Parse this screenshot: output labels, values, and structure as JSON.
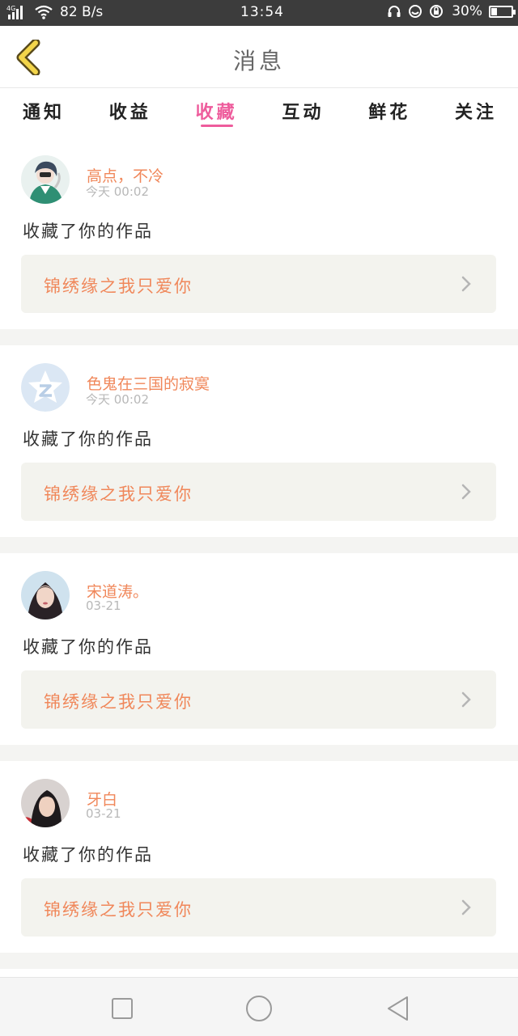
{
  "status_bar": {
    "network": "4G",
    "speed": "82 B/s",
    "time": "13:54",
    "battery": "30%",
    "battery_level": 0.3
  },
  "header": {
    "title": "消息"
  },
  "tabs": [
    {
      "label": "通知",
      "active": false
    },
    {
      "label": "收益",
      "active": false
    },
    {
      "label": "收藏",
      "active": true
    },
    {
      "label": "互动",
      "active": false
    },
    {
      "label": "鲜花",
      "active": false
    },
    {
      "label": "关注",
      "active": false
    }
  ],
  "messages": [
    {
      "username": "高点，不冷",
      "time": "今天 00:02",
      "action": "收藏了你的作品",
      "work": "锦绣缘之我只爱你",
      "avatar": "anime-avatar"
    },
    {
      "username": "色鬼在三国的寂寞",
      "time": "今天 00:02",
      "action": "收藏了你的作品",
      "work": "锦绣缘之我只爱你",
      "avatar": "default-avatar"
    },
    {
      "username": "宋道涛。",
      "time": "03-21",
      "action": "收藏了你的作品",
      "work": "锦绣缘之我只爱你",
      "avatar": "photo-avatar"
    },
    {
      "username": "牙白",
      "time": "03-21",
      "action": "收藏了你的作品",
      "work": "锦绣缘之我只爱你",
      "avatar": "photo-avatar"
    }
  ],
  "colors": {
    "accent": "#ee5c9c",
    "username": "#f0875a",
    "work_box": "#f3f3ee"
  }
}
